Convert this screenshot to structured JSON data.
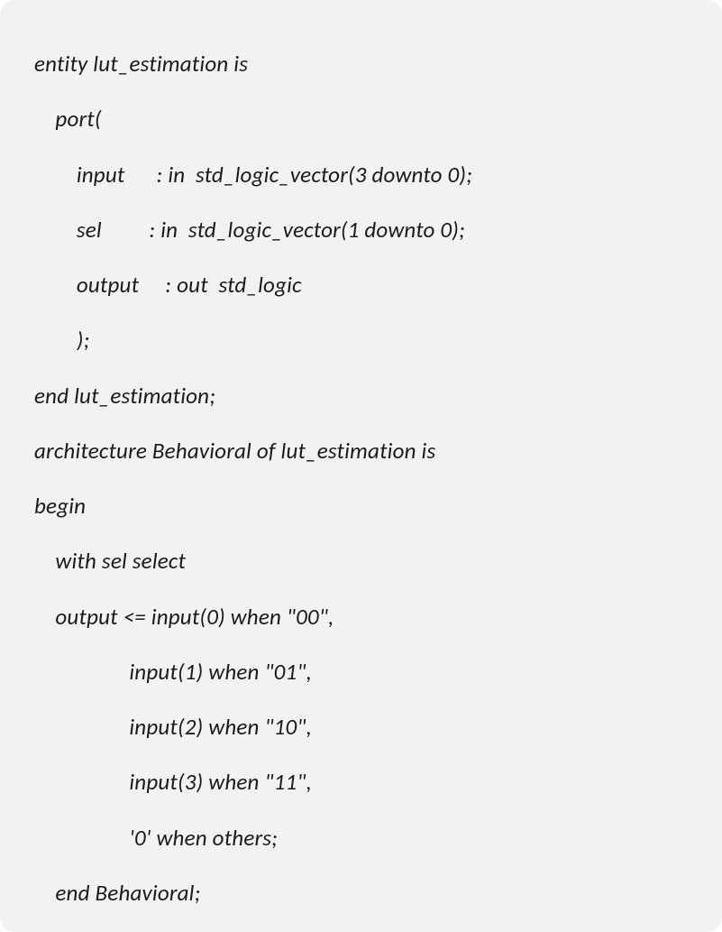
{
  "code": {
    "lines": [
      "entity lut_estimation is",
      "    port(",
      "        input      : in  std_logic_vector(3 downto 0);",
      "        sel         : in  std_logic_vector(1 downto 0);",
      "        output     : out  std_logic",
      "        );",
      "end lut_estimation;",
      "architecture Behavioral of lut_estimation is",
      "begin",
      "    with sel select",
      "    output <= input(0) when \"00\",",
      "                  input(1) when \"01\",",
      "                  input(2) when \"10\",",
      "                  input(3) when \"11\",",
      "                  '0' when others;",
      "    end Behavioral;"
    ]
  }
}
